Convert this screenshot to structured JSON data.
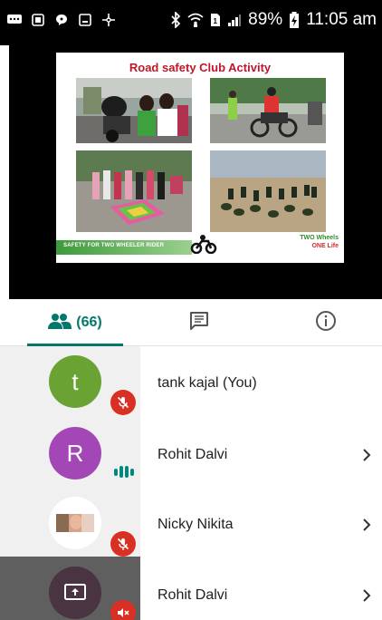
{
  "status_bar": {
    "battery": "89%",
    "time": "11:05 am",
    "icons": [
      "messages-icon",
      "sim-icon",
      "chat-bubble-icon",
      "gallery-icon",
      "fan-icon",
      "bluetooth-icon",
      "wifi-icon",
      "sim1-icon",
      "signal-icon",
      "battery-charging-icon"
    ]
  },
  "slide": {
    "title": "Road safety Club Activity",
    "footer_left": "SAFETY FOR TWO WHEELER RIDER",
    "footer_right_line1": "TWO Wheels",
    "footer_right_line2": "ONE Life"
  },
  "tabs": {
    "people_count": "(66)",
    "people_icon": "people-icon",
    "chat_icon": "chat-icon",
    "info_icon": "info-icon"
  },
  "participants": [
    {
      "initial": "t",
      "name": "tank kajal (You)",
      "avatar_color": "#6aa333",
      "status": "muted",
      "chevron": false
    },
    {
      "initial": "R",
      "name": "Rohit Dalvi",
      "avatar_color": "#a447b6",
      "status": "speaking",
      "chevron": true
    },
    {
      "initial": "",
      "name": "Nicky Nikita",
      "avatar_color": "#ffffff",
      "status": "muted",
      "chevron": true
    },
    {
      "initial": "",
      "name": "Rohit Dalvi",
      "avatar_color": "#4a3442",
      "status": "muted-presenting",
      "chevron": true
    }
  ],
  "colors": {
    "accent": "#00796b",
    "mute_red": "#d93025",
    "slide_title_red": "#c0162a"
  }
}
